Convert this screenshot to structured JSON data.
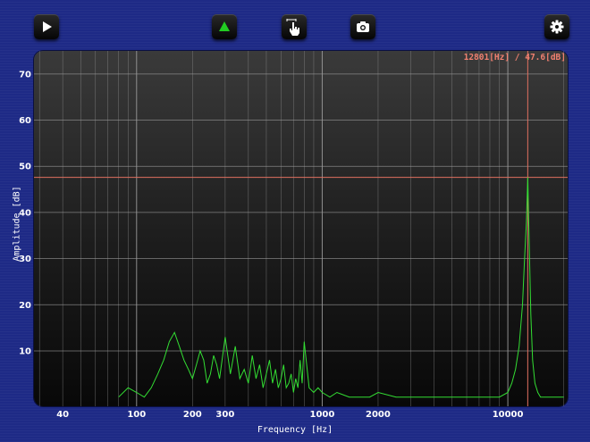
{
  "toolbar": {
    "play": {
      "icon": "play-icon"
    },
    "peak": {
      "icon": "triangle-up-icon",
      "color": "#22cc22"
    },
    "cursor": {
      "icon": "hand-pointer-icon"
    },
    "snapshot": {
      "icon": "camera-icon"
    },
    "settings": {
      "icon": "gear-icon"
    }
  },
  "cursor_readout": "12801[Hz] / 47.6[dB]",
  "colors": {
    "trace": "#33dd33",
    "cursor": "#e07060",
    "grid": "#9a9a9a"
  },
  "chart_data": {
    "type": "line",
    "xscale": "log",
    "xlabel": "Frequency [Hz]",
    "ylabel": "Amplitude [dB]",
    "xlim": [
      28,
      21000
    ],
    "ylim": [
      -2,
      75
    ],
    "x_ticks": [
      {
        "value": 40,
        "label": "40"
      },
      {
        "value": 100,
        "label": "100"
      },
      {
        "value": 200,
        "label": "200"
      },
      {
        "value": 300,
        "label": "300"
      },
      {
        "value": 1000,
        "label": "1000"
      },
      {
        "value": 2000,
        "label": "2000"
      },
      {
        "value": 10000,
        "label": "10000"
      }
    ],
    "y_ticks": [
      {
        "value": 10,
        "label": "10"
      },
      {
        "value": 20,
        "label": "20"
      },
      {
        "value": 30,
        "label": "30"
      },
      {
        "value": 40,
        "label": "40"
      },
      {
        "value": 50,
        "label": "50"
      },
      {
        "value": 60,
        "label": "60"
      },
      {
        "value": 70,
        "label": "70"
      }
    ],
    "grid": true,
    "cursor": {
      "x": 12801,
      "y": 47.6
    },
    "series": [
      {
        "x": [
          80,
          90,
          100,
          110,
          120,
          130,
          140,
          150,
          160,
          170,
          180,
          190,
          200,
          210,
          220,
          230,
          240,
          250,
          260,
          270,
          280,
          300,
          320,
          340,
          360,
          380,
          400,
          420,
          440,
          460,
          480,
          500,
          520,
          540,
          560,
          580,
          600,
          620,
          640,
          660,
          680,
          700,
          720,
          740,
          760,
          780,
          800,
          850,
          900,
          950,
          1000,
          1100,
          1200,
          1400,
          1600,
          1800,
          2000,
          2500,
          3000,
          4000,
          5000,
          6000,
          7000,
          8000,
          9000,
          10000,
          10500,
          11000,
          11500,
          12000,
          12300,
          12600,
          12801,
          13000,
          13300,
          13600,
          14000,
          14500,
          15000,
          16000,
          18000,
          20000
        ],
        "y": [
          0,
          2,
          1,
          0,
          2,
          5,
          8,
          12,
          14,
          11,
          8,
          6,
          4,
          7,
          10,
          8,
          3,
          5,
          9,
          7,
          4,
          13,
          5,
          11,
          4,
          6,
          3,
          9,
          4,
          7,
          2,
          5,
          8,
          3,
          6,
          2,
          4,
          7,
          2,
          3,
          5,
          1,
          4,
          2,
          8,
          3,
          12,
          2,
          1,
          2,
          1,
          0,
          1,
          0,
          0,
          0,
          1,
          0,
          0,
          0,
          0,
          0,
          0,
          0,
          0,
          1,
          3,
          6,
          11,
          20,
          30,
          38,
          47.6,
          35,
          18,
          8,
          3,
          1,
          0,
          0,
          0,
          0
        ]
      }
    ]
  }
}
